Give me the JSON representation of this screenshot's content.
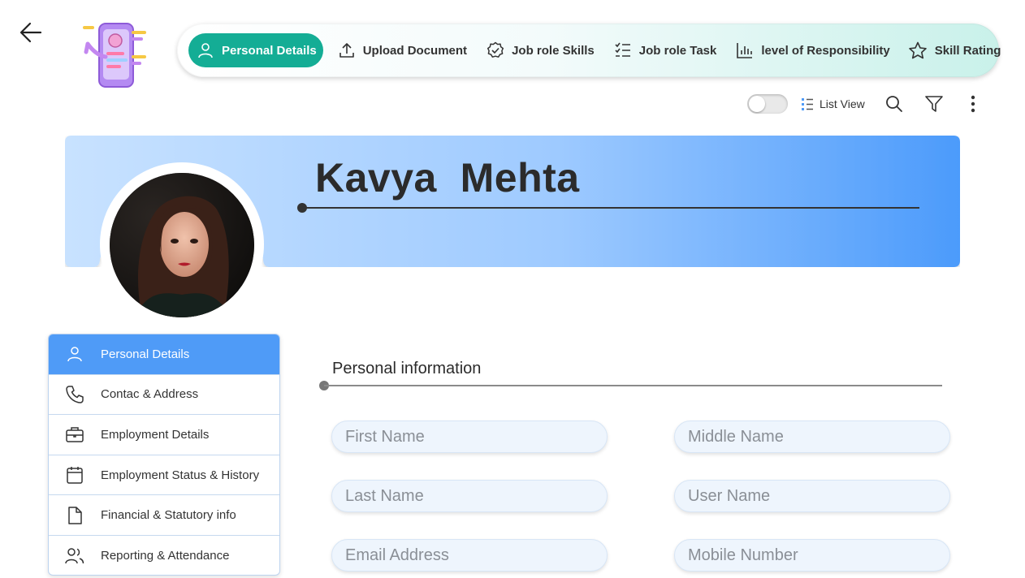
{
  "nav": {
    "tabs": [
      {
        "label": "Personal Details",
        "icon": "user-icon",
        "active": true
      },
      {
        "label": "Upload Document",
        "icon": "upload-icon"
      },
      {
        "label": "Job role Skills",
        "icon": "badge-check-icon"
      },
      {
        "label": "Job role Task",
        "icon": "checklist-icon"
      },
      {
        "label": "level of Responsibility",
        "icon": "bar-chart-icon"
      },
      {
        "label": "Skill Rating",
        "icon": "star-icon"
      }
    ]
  },
  "toolbar": {
    "list_view_label": "List View",
    "toggle_on": false
  },
  "profile": {
    "name": "Kavya  Mehta"
  },
  "sidebar": {
    "items": [
      {
        "label": "Personal Details",
        "icon": "user-icon",
        "active": true
      },
      {
        "label": "Contac & Address",
        "icon": "phone-icon"
      },
      {
        "label": "Employment Details",
        "icon": "briefcase-icon"
      },
      {
        "label": "Employment Status & History",
        "icon": "calendar-icon"
      },
      {
        "label": "Financial & Statutory info",
        "icon": "document-icon"
      },
      {
        "label": "Reporting & Attendance",
        "icon": "users-icon"
      }
    ]
  },
  "form": {
    "section_title": "Personal information",
    "fields": {
      "first_name": {
        "placeholder": "First Name",
        "value": ""
      },
      "middle_name": {
        "placeholder": "Middle Name",
        "value": ""
      },
      "last_name": {
        "placeholder": "Last Name",
        "value": ""
      },
      "user_name": {
        "placeholder": "User Name",
        "value": ""
      },
      "email": {
        "placeholder": "Email Address",
        "value": ""
      },
      "mobile": {
        "placeholder": "Mobile Number",
        "value": ""
      }
    }
  },
  "colors": {
    "accent_teal": "#14ad95",
    "accent_blue": "#4f9bf7",
    "banner_start": "#c8e2ff",
    "banner_end": "#4c9bfb"
  }
}
